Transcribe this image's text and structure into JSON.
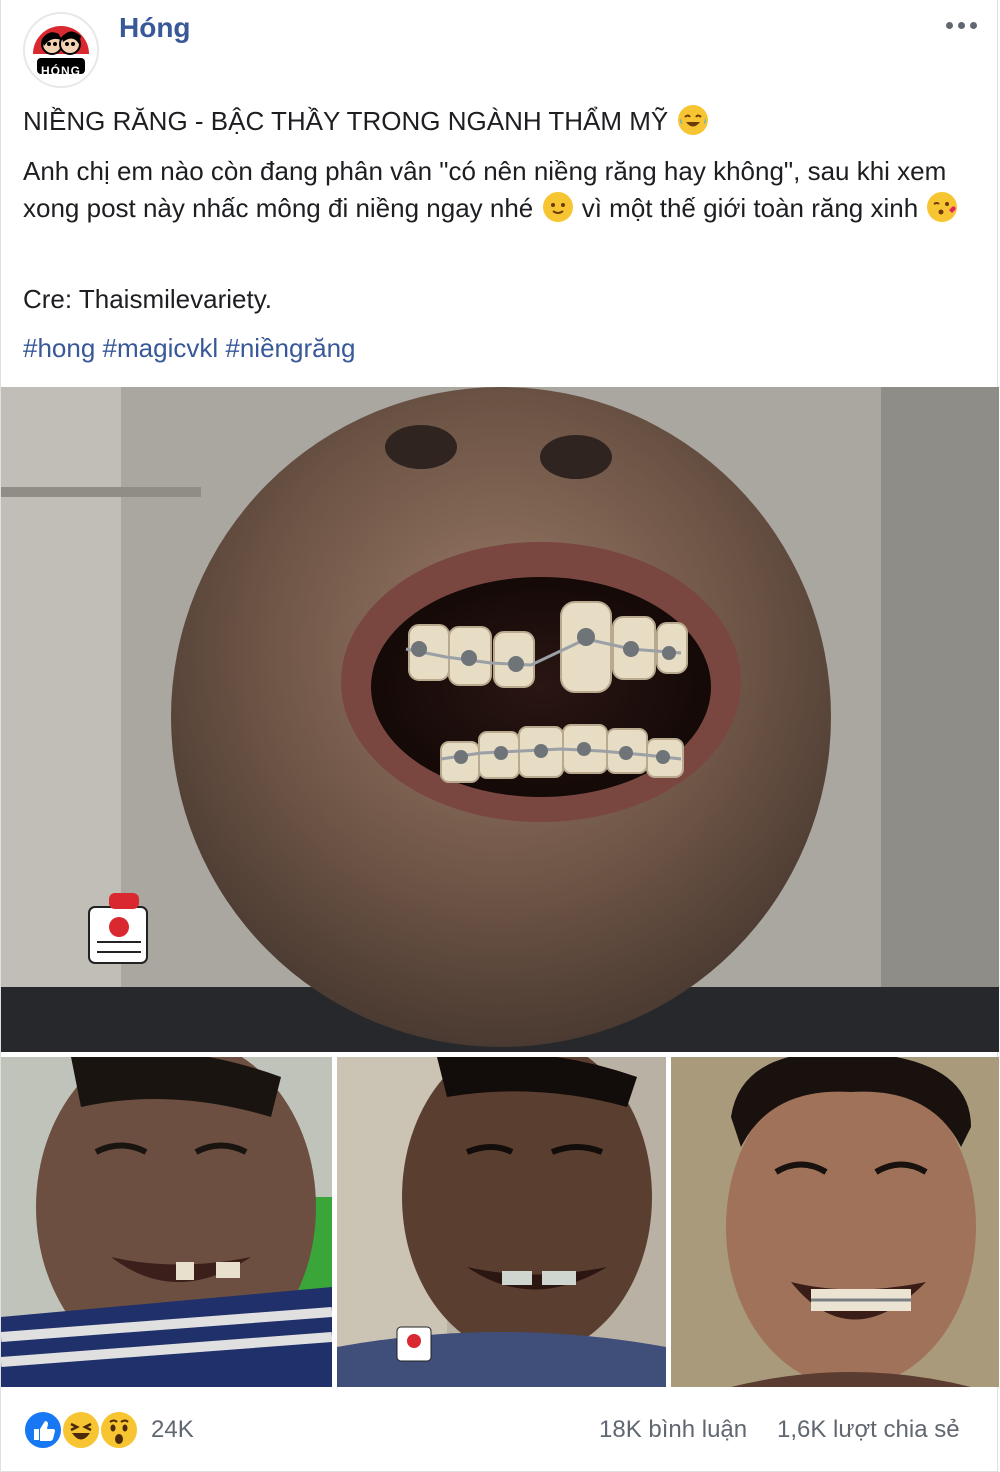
{
  "page": {
    "name": "Hóng",
    "avatar_label": "HÓNG"
  },
  "post": {
    "title": "NIỀNG RĂNG - BẬC THẦY TRONG NGÀNH THẨM MỸ",
    "body_part1": "Anh chị em nào còn đang phân vân \"có nên niềng răng hay không\", sau khi xem xong post này nhấc mông đi niềng ngay nhé",
    "body_part2": "vì một thế giới toàn răng xinh",
    "credit": "Cre: Thaismilevariety.",
    "hashtags": [
      "#hong",
      "#magicvkl",
      "#niềngrăng"
    ],
    "emojis": [
      "laughing-crying-emoji",
      "smiling-emoji",
      "kissing-heart-emoji"
    ]
  },
  "media": {
    "main_photo": "close-up-smile-with-braces",
    "thumbnails": [
      "smile-before-braces",
      "smile-with-braces-gap",
      "smile-braces-result"
    ]
  },
  "reactions": {
    "icons": [
      "like-reaction-icon",
      "haha-reaction-icon",
      "wow-reaction-icon"
    ],
    "count": "24K",
    "comments": "18K bình luận",
    "shares": "1,6K lượt chia sẻ"
  },
  "colors": {
    "link": "#385898",
    "muted": "#606770",
    "like": "#1877f2",
    "emoji": "#f7c531"
  }
}
